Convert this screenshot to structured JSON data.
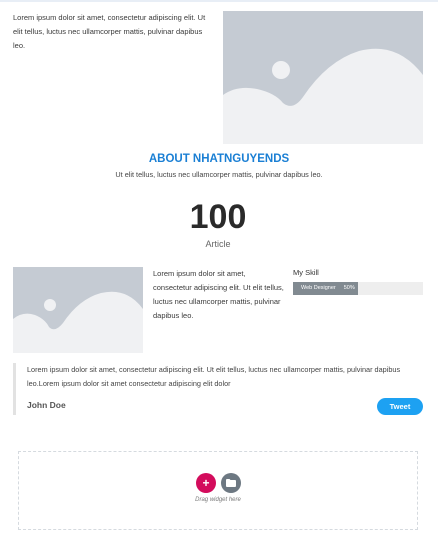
{
  "hero": {
    "text": "Lorem ipsum dolor sit amet, consectetur adipiscing elit. Ut elit tellus, luctus nec ullamcorper mattis, pulvinar dapibus leo."
  },
  "about": {
    "title": "ABOUT NHATNGUYENDS",
    "subtitle": "Ut elit tellus, luctus nec ullamcorper mattis, pulvinar dapibus leo."
  },
  "counter": {
    "value": "100",
    "label": "Article"
  },
  "feature": {
    "text": "Lorem ipsum dolor sit amet, consectetur adipiscing elit. Ut elit tellus, luctus nec ullamcorper mattis, pulvinar dapibus leo."
  },
  "skills": {
    "title": "My Skill",
    "items": [
      {
        "label": "Web Designer",
        "percent_text": "50%",
        "percent": 50
      }
    ]
  },
  "quote": {
    "text": "Lorem ipsum dolor sit amet, consectetur adipiscing elit. Ut elit tellus, luctus nec ullamcorper mattis, pulvinar dapibus leo.Lorem ipsum dolor sit amet consectetur adipiscing elit dolor",
    "author": "John Doe",
    "tweet_label": "Tweet"
  },
  "drop_zone": {
    "add_symbol": "+",
    "label": "Drag widget here"
  },
  "icons": {
    "image_placeholder": "image-placeholder-icon",
    "add": "plus-icon",
    "template": "folder-icon"
  },
  "colors": {
    "heading_accent": "#1a7fd4",
    "tweet_button": "#1da1f2",
    "add_button": "#d30c5c",
    "folder_button": "#6d7882",
    "skill_bar": "#818a91"
  }
}
